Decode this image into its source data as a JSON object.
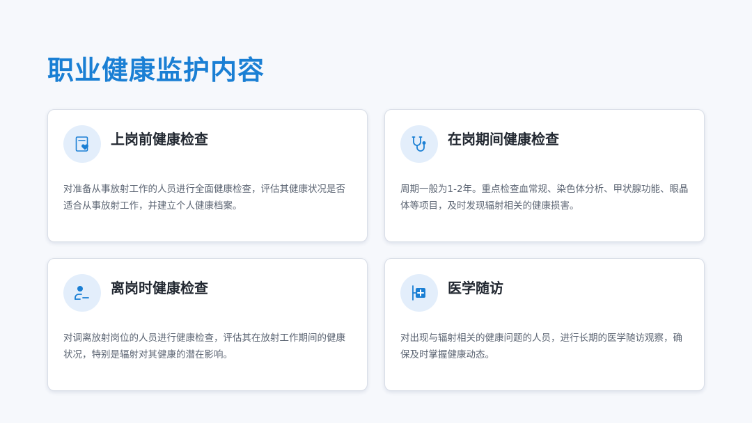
{
  "page": {
    "title": "职业健康监护内容"
  },
  "colors": {
    "accent": "#1a7fd4",
    "icon_bg": "#e3eefb",
    "card_bg": "#ffffff",
    "page_bg": "#f6f8fc"
  },
  "cards": [
    {
      "icon": "clipboard-heart-icon",
      "title": "上岗前健康检查",
      "description": "对准备从事放射工作的人员进行全面健康检查，评估其健康状况是否适合从事放射工作，并建立个人健康档案。"
    },
    {
      "icon": "stethoscope-icon",
      "title": "在岗期间健康检查",
      "description": "周期一般为1-2年。重点检查血常规、染色体分析、甲状腺功能、眼晶体等项目，及时发现辐射相关的健康损害。"
    },
    {
      "icon": "user-minus-icon",
      "title": "离岗时健康检查",
      "description": "对调离放射岗位的人员进行健康检查，评估其在放射工作期间的健康状况，特别是辐射对其健康的潜在影响。"
    },
    {
      "icon": "medical-follow-up-icon",
      "title": "医学随访",
      "description": "对出现与辐射相关的健康问题的人员，进行长期的医学随访观察，确保及时掌握健康动态。"
    }
  ]
}
